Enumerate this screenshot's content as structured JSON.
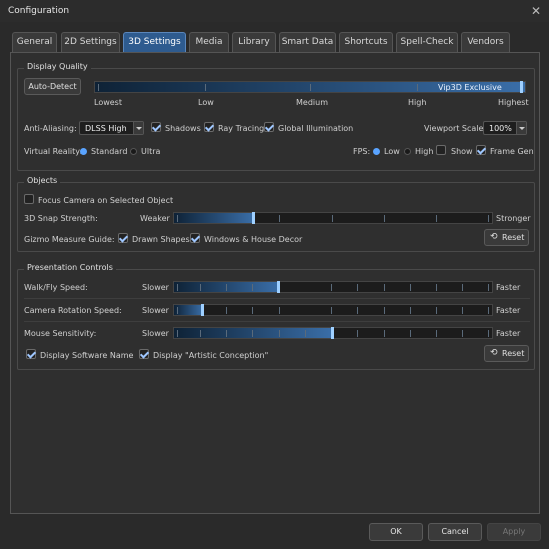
{
  "window": {
    "title": "Configuration",
    "close_glyph": "✕"
  },
  "tabs": [
    {
      "label": "General",
      "active": false
    },
    {
      "label": "2D Settings",
      "active": false
    },
    {
      "label": "3D Settings",
      "active": true
    },
    {
      "label": "Media",
      "active": false
    },
    {
      "label": "Library",
      "active": false
    },
    {
      "label": "Smart Data",
      "active": false
    },
    {
      "label": "Shortcuts",
      "active": false
    },
    {
      "label": "Spell-Check",
      "active": false
    },
    {
      "label": "Vendors",
      "active": false
    }
  ],
  "display_quality": {
    "group_label": "Display Quality",
    "auto_detect_label": "Auto-Detect",
    "slider_current_label": "Vip3D Exclusive",
    "slider_level": 1.0,
    "scale_labels": [
      "Lowest",
      "Low",
      "Medium",
      "High",
      "Highest"
    ],
    "anti_aliasing_label": "Anti-Aliasing:",
    "anti_aliasing_value": "DLSS High",
    "shadows_label": "Shadows",
    "shadows_checked": true,
    "ray_tracing_label": "Ray Tracing",
    "ray_tracing_checked": true,
    "gi_label": "Global Illumination",
    "gi_checked": true,
    "viewport_scale_label": "Viewport Scale:",
    "viewport_scale_value": "100%",
    "vr_label": "Virtual Reality:",
    "vr_standard_label": "Standard",
    "vr_ultra_label": "Ultra",
    "vr_selected": "Standard",
    "fps_label": "FPS:",
    "fps_low_label": "Low",
    "fps_high_label": "High",
    "fps_selected": "Low",
    "show_label": "Show",
    "show_checked": false,
    "frame_gen_label": "Frame Gen",
    "frame_gen_checked": true
  },
  "objects": {
    "group_label": "Objects",
    "focus_camera_label": "Focus Camera on Selected Object",
    "focus_camera_checked": false,
    "snap_label": "3D Snap Strength:",
    "snap_min": "Weaker",
    "snap_max": "Stronger",
    "snap_level": 0.25,
    "gizmo_label": "Gizmo Measure Guide:",
    "drawn_shapes_label": "Drawn Shapes",
    "drawn_shapes_checked": true,
    "windows_label": "Windows & House Decor",
    "windows_checked": true,
    "reset_label": "Reset"
  },
  "presentation": {
    "group_label": "Presentation Controls",
    "walk_label": "Walk/Fly Speed:",
    "walk_min": "Slower",
    "walk_max": "Faster",
    "walk_level": 0.33,
    "camera_label": "Camera Rotation Speed:",
    "camera_min": "Slower",
    "camera_max": "Faster",
    "camera_level": 0.09,
    "mouse_label": "Mouse Sensitivity:",
    "mouse_min": "Slower",
    "mouse_max": "Faster",
    "mouse_level": 0.5,
    "display_software_label": "Display Software Name",
    "display_software_checked": true,
    "artistic_label": "Display \"Artistic Conception\"",
    "artistic_checked": true,
    "reset_label": "Reset"
  },
  "footer": {
    "ok_label": "OK",
    "cancel_label": "Cancel",
    "apply_label": "Apply"
  }
}
